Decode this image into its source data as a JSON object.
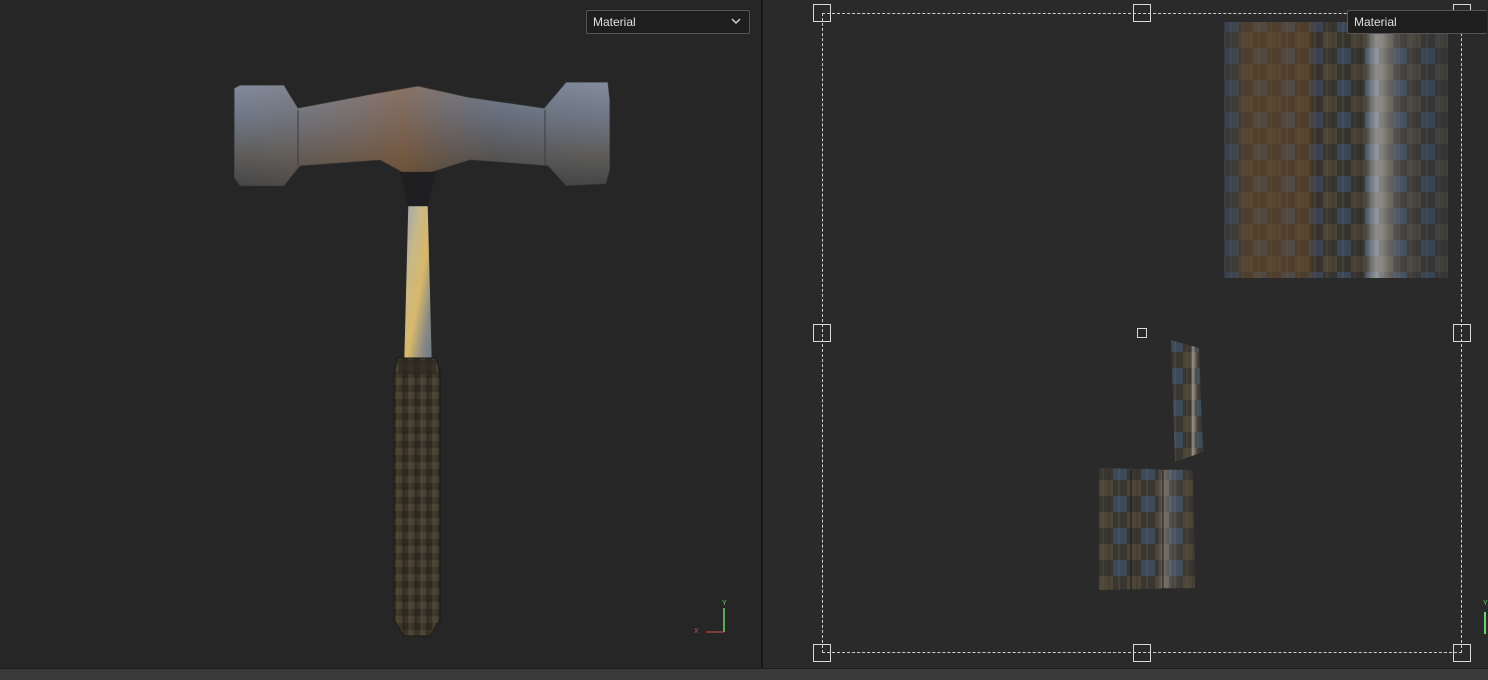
{
  "viewport3d": {
    "material_dropdown": {
      "value": "Material"
    },
    "model": {
      "object": "hammer-model"
    },
    "gizmo": {
      "y_label": "Y",
      "x_label": "X"
    }
  },
  "uv_editor": {
    "material_dropdown": {
      "value": "Material"
    },
    "islands": [
      "uv-island-head",
      "uv-island-handle-strip",
      "uv-island-handle-grip"
    ],
    "gizmo": {
      "y_label": "Y"
    }
  },
  "colors": {
    "viewport_bg": "#262626",
    "uv_bg": "#2a2a2a",
    "gizmo_y": "#6cd46c",
    "gizmo_x": "#d05050",
    "boundary": "#cfcfcf"
  }
}
